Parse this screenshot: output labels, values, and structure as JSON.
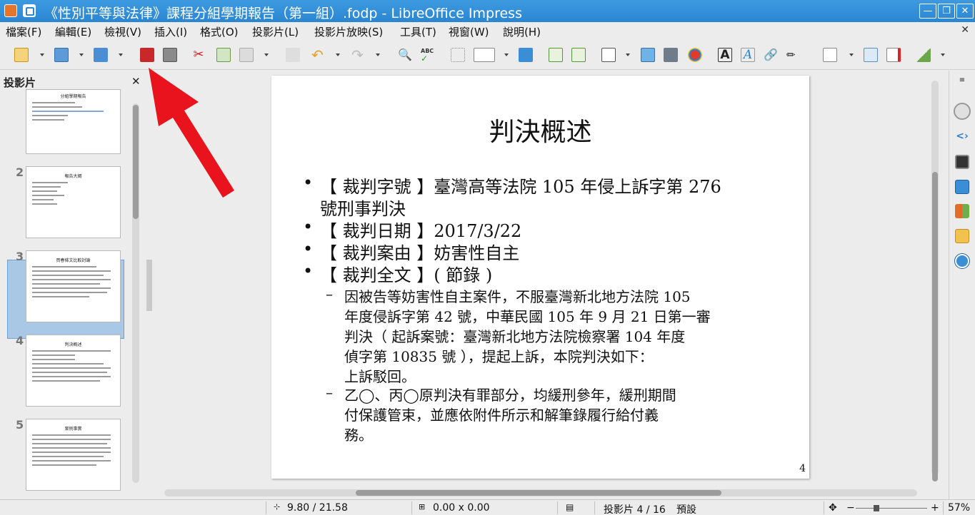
{
  "window": {
    "title": "《性別平等與法律》課程分組學期報告（第一組）.fodp - LibreOffice Impress",
    "minimize": "—",
    "maximize": "❐",
    "close": "✕"
  },
  "menu": {
    "items": [
      "檔案(F)",
      "編輯(E)",
      "檢視(V)",
      "插入(I)",
      "格式(O)",
      "投影片(L)",
      "投影片放映(S)",
      "工具(T)",
      "視窗(W)",
      "說明(H)"
    ],
    "close_glyph": "✕"
  },
  "slide_pane": {
    "header": "投影片",
    "close_glyph": "✕",
    "thumbnails": [
      {
        "number": "",
        "title": "分組學期報告"
      },
      {
        "number": "2",
        "title": "報告大綱"
      },
      {
        "number": "3",
        "title": "買春條文比較討論"
      },
      {
        "number": "4",
        "title": "判決概述"
      },
      {
        "number": "5",
        "title": "案例事實"
      }
    ]
  },
  "slide": {
    "title": "判決概述",
    "bullets": [
      {
        "text": "【 裁判字號 】臺灣高等法院 105 年侵上訴字第 276",
        "cont": "號刑事判決"
      },
      {
        "text": "【 裁判日期 】2017/3/22"
      },
      {
        "text": "【 裁判案由 】妨害性自主"
      },
      {
        "text": "【 裁判全文 】( 節錄 )"
      }
    ],
    "sub1": [
      "因被告等妨害性自主案件，不服臺灣新北地方法院 105",
      "年度侵訴字第 42 號，中華民國 105 年 9 月 21 日第一審",
      "判決（ 起訴案號：臺灣新北地方法院檢察署 104 年度",
      "偵字第 10835 號 ），提起上訴，本院判決如下：",
      "上訴駁回。"
    ],
    "sub2": [
      "乙◯、丙◯原判決有罪部分，均緩刑參年，緩刑期間",
      "付保護管束，並應依附件所示和解筆錄履行給付義",
      "務。"
    ],
    "dash": "–",
    "page_number": "4"
  },
  "status": {
    "position": "9.80 / 21.58",
    "size": "0.00 x 0.00",
    "slide": "投影片 4 / 16",
    "layout": "預設",
    "zoom": "57%"
  },
  "colors": {
    "titlebar": "#2b86d1",
    "arrow": "#e8131c",
    "selected_thumb": "#a9c8e6"
  }
}
